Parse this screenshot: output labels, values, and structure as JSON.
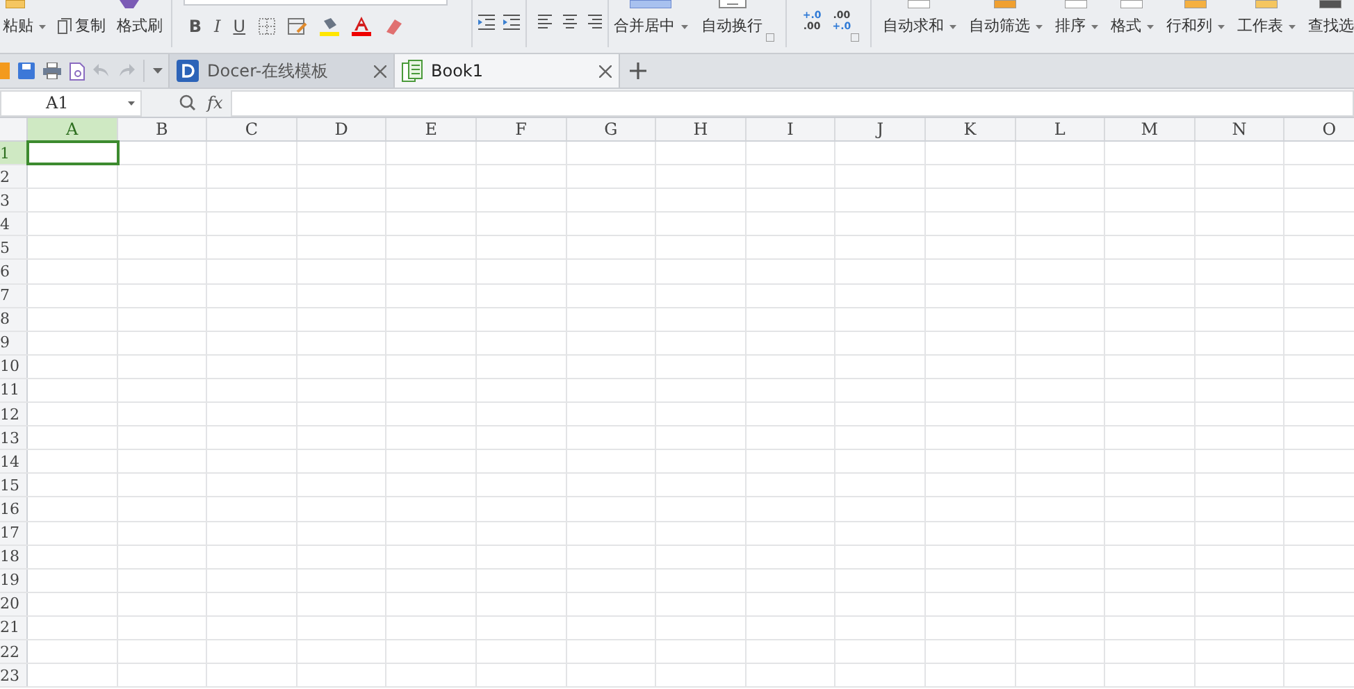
{
  "ribbon": {
    "clipboard": [
      {
        "kind": "paste",
        "label": "粘贴"
      },
      {
        "kind": "copy",
        "label": "复制"
      },
      {
        "kind": "painter",
        "label": "格式刷"
      }
    ],
    "font_styles": [
      "B",
      "I",
      "U"
    ],
    "number_buttons": [
      {
        "top": "+.0",
        "bottom": ".00"
      },
      {
        "top": ".00",
        "bottom": "+.0"
      }
    ],
    "merge": {
      "label": "合并居中"
    },
    "wrap": {
      "label": "自动换行"
    },
    "tools": [
      {
        "label": "自动求和",
        "dropdown": true
      },
      {
        "label": "自动筛选",
        "dropdown": true
      },
      {
        "label": "排序",
        "dropdown": true
      },
      {
        "label": "格式",
        "dropdown": true
      },
      {
        "label": "行和列",
        "dropdown": true
      },
      {
        "label": "工作表",
        "dropdown": true
      },
      {
        "label": "查找选",
        "dropdown": false
      }
    ]
  },
  "doc_tabs": [
    {
      "title": "Docer-在线模板",
      "kind": "docer",
      "selected": false
    },
    {
      "title": "Book1",
      "kind": "sheet",
      "selected": true
    }
  ],
  "formula_bar": {
    "name_box": "A1",
    "fx": "fx"
  },
  "columns": [
    {
      "label": "A",
      "selected": true
    },
    {
      "label": "B",
      "selected": false
    },
    {
      "label": "C",
      "selected": false
    },
    {
      "label": "D",
      "selected": false
    },
    {
      "label": "E",
      "selected": false
    },
    {
      "label": "F",
      "selected": false
    },
    {
      "label": "G",
      "selected": false
    },
    {
      "label": "H",
      "selected": false
    },
    {
      "label": "I",
      "selected": false
    },
    {
      "label": "J",
      "selected": false
    },
    {
      "label": "K",
      "selected": false
    },
    {
      "label": "L",
      "selected": false
    },
    {
      "label": "M",
      "selected": false
    },
    {
      "label": "N",
      "selected": false
    },
    {
      "label": "O",
      "selected": false
    }
  ],
  "rows": [
    {
      "label": "1",
      "selected": true
    },
    {
      "label": "2",
      "selected": false
    },
    {
      "label": "3",
      "selected": false
    },
    {
      "label": "4",
      "selected": false
    },
    {
      "label": "5",
      "selected": false
    },
    {
      "label": "6",
      "selected": false
    },
    {
      "label": "7",
      "selected": false
    },
    {
      "label": "8",
      "selected": false
    },
    {
      "label": "9",
      "selected": false
    },
    {
      "label": "10",
      "selected": false
    },
    {
      "label": "11",
      "selected": false
    },
    {
      "label": "12",
      "selected": false
    },
    {
      "label": "13",
      "selected": false
    },
    {
      "label": "14",
      "selected": false
    },
    {
      "label": "15",
      "selected": false
    },
    {
      "label": "16",
      "selected": false
    },
    {
      "label": "17",
      "selected": false
    },
    {
      "label": "18",
      "selected": false
    },
    {
      "label": "19",
      "selected": false
    },
    {
      "label": "20",
      "selected": false
    },
    {
      "label": "21",
      "selected": false
    },
    {
      "label": "22",
      "selected": false
    },
    {
      "label": "23",
      "selected": false
    }
  ]
}
